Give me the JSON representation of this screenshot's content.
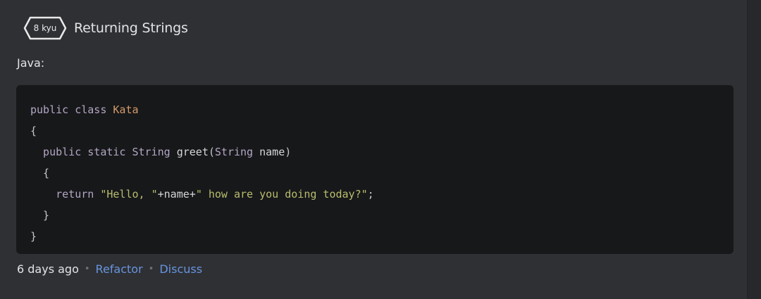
{
  "kata": {
    "rank": "8 kyu",
    "title": "Returning Strings",
    "language": "Java:"
  },
  "code": {
    "lines": [
      [
        {
          "t": "public class ",
          "c": "kw"
        },
        {
          "t": "Kata",
          "c": "cls"
        }
      ],
      [
        {
          "t": "{",
          "c": "punct"
        }
      ],
      [
        {
          "t": "  public static ",
          "c": "kw"
        },
        {
          "t": "String",
          "c": "type"
        },
        {
          "t": " greet",
          "c": "plain"
        },
        {
          "t": "(",
          "c": "punct"
        },
        {
          "t": "String",
          "c": "type"
        },
        {
          "t": " name",
          "c": "plain"
        },
        {
          "t": ")",
          "c": "punct"
        }
      ],
      [
        {
          "t": "  {",
          "c": "punct"
        }
      ],
      [
        {
          "t": "    return ",
          "c": "kw"
        },
        {
          "t": "\"Hello, \"",
          "c": "str"
        },
        {
          "t": "+name+",
          "c": "plain"
        },
        {
          "t": "\" how are you doing today?\"",
          "c": "str"
        },
        {
          "t": ";",
          "c": "punct"
        }
      ],
      [
        {
          "t": "  }",
          "c": "punct"
        }
      ],
      [
        {
          "t": "}",
          "c": "punct"
        }
      ]
    ]
  },
  "footer": {
    "time_ago": "6 days ago",
    "separator": "•",
    "refactor_label": "Refactor",
    "discuss_label": "Discuss"
  },
  "colors": {
    "keyword": "#b3a6c4",
    "class_name": "#d49a6a",
    "string": "#b9bd6d",
    "link": "#6795de",
    "code_background": "#17181a"
  },
  "icons": {
    "rank_badge": "hexagon-badge-icon"
  }
}
